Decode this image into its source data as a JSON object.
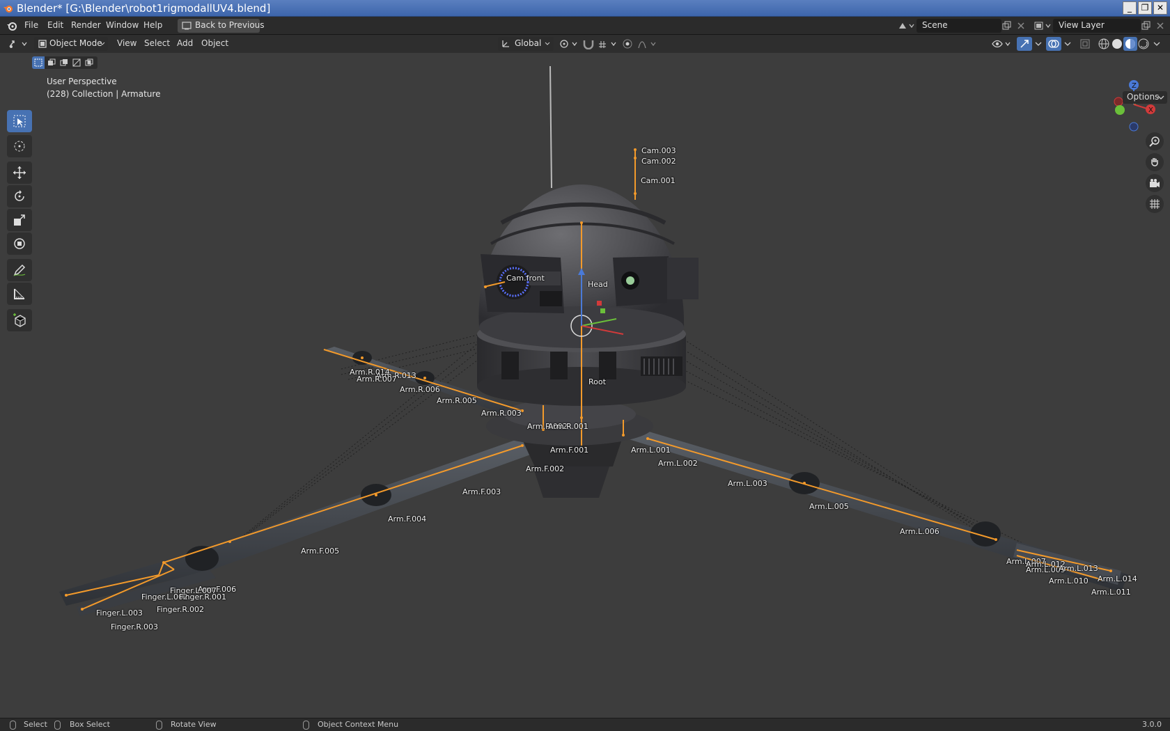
{
  "window": {
    "title": "Blender* [G:\\Blender\\robot1rigmodallUV4.blend]",
    "buttons": {
      "minimize": "_",
      "restore": "❐",
      "close": "✕"
    }
  },
  "menu": {
    "items": [
      "File",
      "Edit",
      "Render",
      "Window",
      "Help"
    ],
    "back_button": "Back to Previous",
    "scene_name": "Scene",
    "view_layer": "View Layer"
  },
  "viewport_header": {
    "mode": "Object Mode",
    "menus": [
      "View",
      "Select",
      "Add",
      "Object"
    ],
    "orientation": "Global",
    "options": "Options"
  },
  "viewport_info": {
    "perspective": "User Perspective",
    "collection": "(228) Collection | Armature"
  },
  "gizmo": {
    "z": "Z",
    "y": "Y",
    "x": "X"
  },
  "bones": [
    {
      "name": "Cam.003"
    },
    {
      "name": "Cam.002"
    },
    {
      "name": "Cam.001"
    },
    {
      "name": "Cam.front"
    },
    {
      "name": "Head"
    },
    {
      "name": "Root"
    },
    {
      "name": "Arm.R.014"
    },
    {
      "name": "Arm.R.013"
    },
    {
      "name": "Arm.R.007"
    },
    {
      "name": "Arm.R.006"
    },
    {
      "name": "Arm.R.005"
    },
    {
      "name": "Arm.R.003"
    },
    {
      "name": "Arm.R.002"
    },
    {
      "name": "Arm.R.001"
    },
    {
      "name": "Arm.F.001"
    },
    {
      "name": "Arm.F.002"
    },
    {
      "name": "Arm.F.003"
    },
    {
      "name": "Arm.F.004"
    },
    {
      "name": "Arm.F.005"
    },
    {
      "name": "Arm.F.006"
    },
    {
      "name": "Arm.L.001"
    },
    {
      "name": "Arm.L.002"
    },
    {
      "name": "Arm.L.003"
    },
    {
      "name": "Arm.L.005"
    },
    {
      "name": "Arm.L.006"
    },
    {
      "name": "Arm.L.007"
    },
    {
      "name": "Arm.L.009"
    },
    {
      "name": "Arm.L.012"
    },
    {
      "name": "Arm.L.013"
    },
    {
      "name": "Arm.L.010"
    },
    {
      "name": "Arm.L.014"
    },
    {
      "name": "Arm.L.011"
    },
    {
      "name": "Finger.L.007"
    },
    {
      "name": "Finger.L.002"
    },
    {
      "name": "Finger.R.001"
    },
    {
      "name": "Finger.R.002"
    },
    {
      "name": "Finger.L.003"
    },
    {
      "name": "Finger.R.003"
    }
  ],
  "statusbar": {
    "select": "Select",
    "box_select": "Box Select",
    "rotate_view": "Rotate View",
    "context_menu": "Object Context Menu",
    "version": "3.0.0"
  }
}
